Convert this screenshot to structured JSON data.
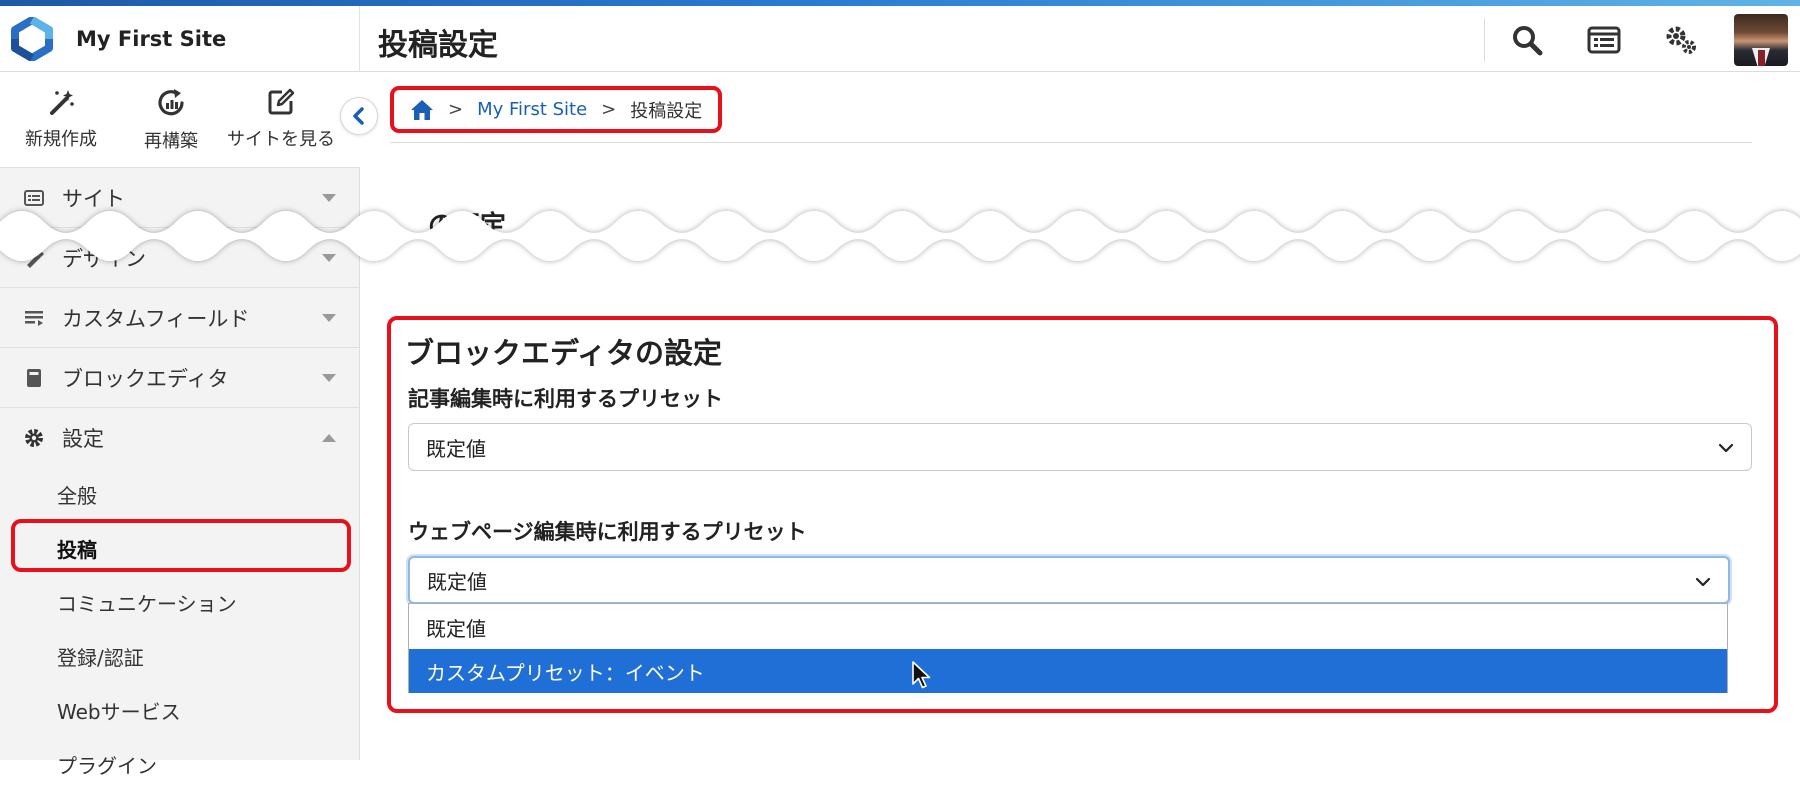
{
  "header": {
    "site_name": "My First Site",
    "page_title": "投稿設定",
    "icons": [
      "search-icon",
      "list-view-icon",
      "settings-cogs-icon"
    ],
    "accent_color": "#1d5aa8"
  },
  "sidebar": {
    "quick_actions": [
      {
        "label": "新規作成",
        "icon": "magic-wand-icon"
      },
      {
        "label": "再構築",
        "icon": "rebuild-icon"
      },
      {
        "label": "サイトを見る",
        "icon": "external-view-icon"
      }
    ],
    "menu": [
      {
        "label": "サイト",
        "icon": "site-icon",
        "expanded": false
      },
      {
        "label": "デザイン",
        "icon": "design-icon",
        "expanded": false
      },
      {
        "label": "カスタムフィールド",
        "icon": "custom-field-icon",
        "expanded": false
      },
      {
        "label": "ブロックエディタ",
        "icon": "block-editor-icon",
        "expanded": false
      },
      {
        "label": "設定",
        "icon": "gear-icon",
        "expanded": true
      }
    ],
    "settings_submenu": [
      {
        "label": "全般",
        "active": false
      },
      {
        "label": "投稿",
        "active": true
      },
      {
        "label": "コミュニケーション",
        "active": false
      },
      {
        "label": "登録/認証",
        "active": false
      },
      {
        "label": "Webサービス",
        "active": false
      },
      {
        "label": "プラグイン",
        "active": false
      }
    ]
  },
  "breadcrumb": {
    "site": "My First Site",
    "current": "投稿設定",
    "separator": ">"
  },
  "main": {
    "partial_heading": "の既定",
    "section_title": "ブロックエディタの設定",
    "entry_preset_label": "記事編集時に利用するプリセット",
    "entry_preset_value": "既定値",
    "page_preset_label": "ウェブページ編集時に利用するプリセット",
    "page_preset_value": "既定値",
    "page_preset_options": [
      "既定値",
      "カスタムプリセット：イベント"
    ],
    "highlighted_option_index": 1,
    "highlight_color": "#1f6fd6",
    "annotation_color": "#e8101a"
  }
}
